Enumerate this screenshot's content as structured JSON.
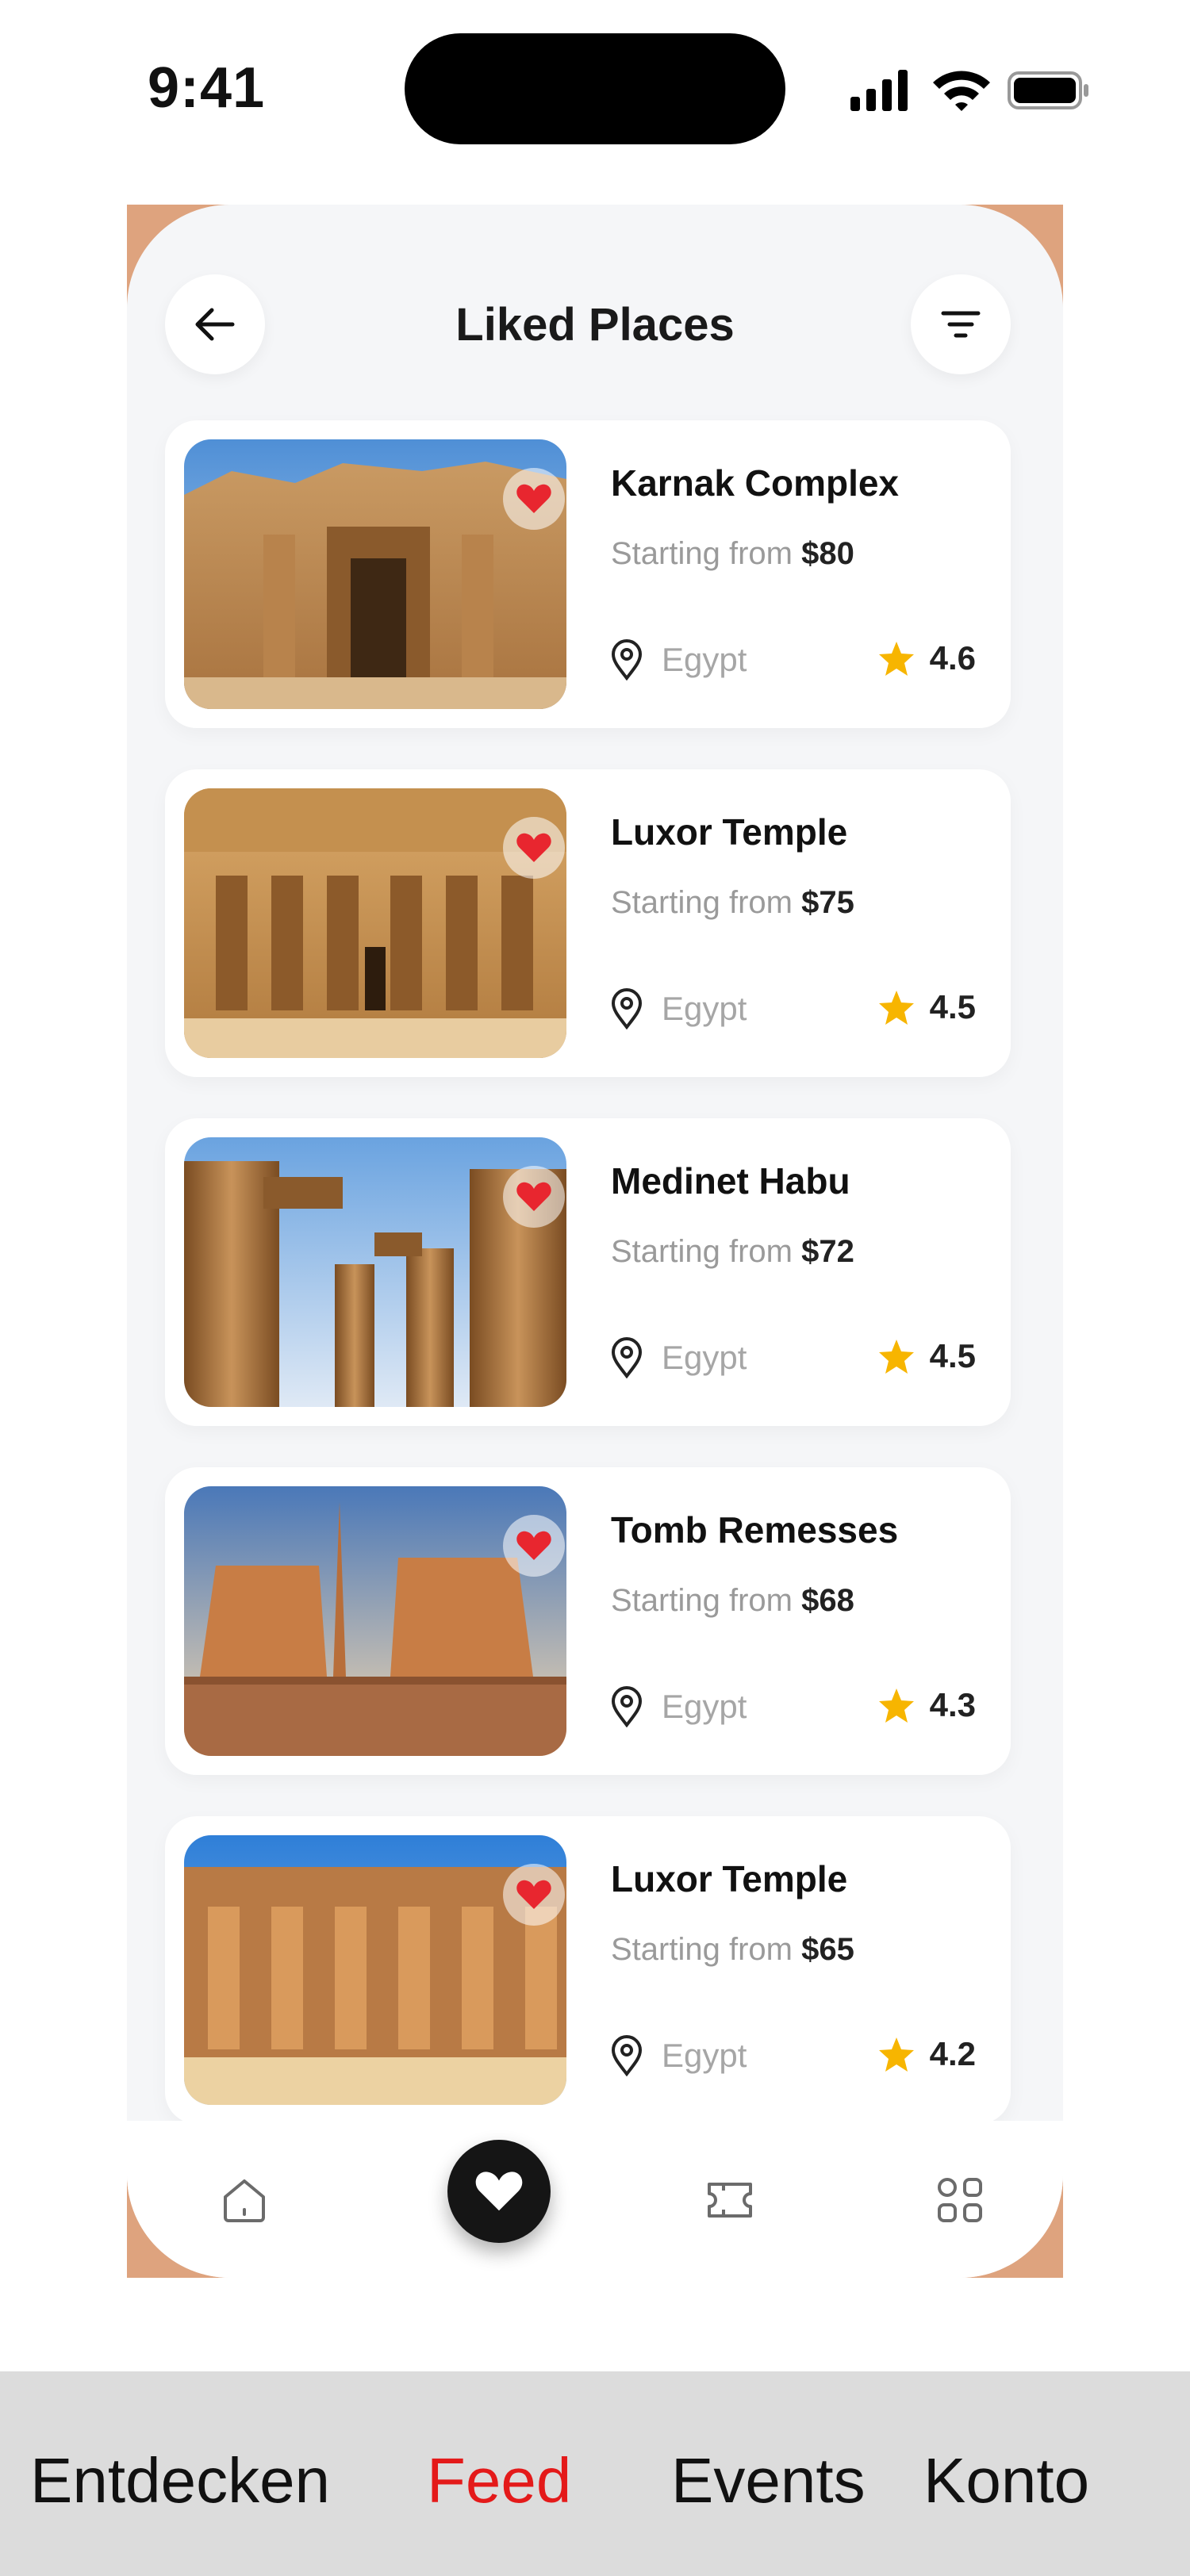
{
  "status_bar": {
    "time": "9:41"
  },
  "header": {
    "title": "Liked Places"
  },
  "places": [
    {
      "name": "Karnak Complex",
      "price_prefix": "Starting from",
      "price": "$80",
      "location": "Egypt",
      "rating": "4.6"
    },
    {
      "name": "Luxor Temple",
      "price_prefix": "Starting from",
      "price": "$75",
      "location": "Egypt",
      "rating": "4.5"
    },
    {
      "name": "Medinet Habu",
      "price_prefix": "Starting from",
      "price": "$72",
      "location": "Egypt",
      "rating": "4.5"
    },
    {
      "name": "Tomb Remesses",
      "price_prefix": "Starting from",
      "price": "$68",
      "location": "Egypt",
      "rating": "4.3"
    },
    {
      "name": "Luxor Temple",
      "price_prefix": "Starting from",
      "price": "$65",
      "location": "Egypt",
      "rating": "4.2"
    }
  ],
  "bottom_nav": {
    "items": [
      "home-icon",
      "heart-icon",
      "ticket-icon",
      "grid-icon"
    ],
    "active": "heart-icon"
  },
  "tabbar": {
    "tabs": [
      "Entdecken",
      "Feed",
      "Events",
      "Konto"
    ],
    "active": "Feed"
  },
  "colors": {
    "accent_heart": "#e8262f",
    "star": "#f7b500",
    "active_tab": "#e41a1a",
    "frame_border": "#dea37e"
  }
}
